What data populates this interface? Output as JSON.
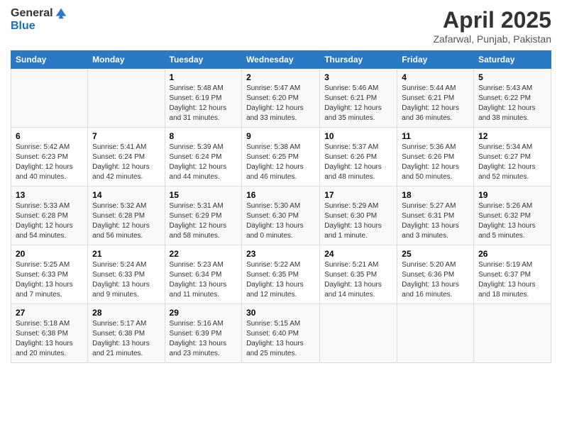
{
  "header": {
    "logo_general": "General",
    "logo_blue": "Blue",
    "title": "April 2025",
    "location": "Zafarwal, Punjab, Pakistan"
  },
  "weekdays": [
    "Sunday",
    "Monday",
    "Tuesday",
    "Wednesday",
    "Thursday",
    "Friday",
    "Saturday"
  ],
  "weeks": [
    [
      {
        "day": "",
        "sunrise": "",
        "sunset": "",
        "daylight": ""
      },
      {
        "day": "",
        "sunrise": "",
        "sunset": "",
        "daylight": ""
      },
      {
        "day": "1",
        "sunrise": "Sunrise: 5:48 AM",
        "sunset": "Sunset: 6:19 PM",
        "daylight": "Daylight: 12 hours and 31 minutes."
      },
      {
        "day": "2",
        "sunrise": "Sunrise: 5:47 AM",
        "sunset": "Sunset: 6:20 PM",
        "daylight": "Daylight: 12 hours and 33 minutes."
      },
      {
        "day": "3",
        "sunrise": "Sunrise: 5:46 AM",
        "sunset": "Sunset: 6:21 PM",
        "daylight": "Daylight: 12 hours and 35 minutes."
      },
      {
        "day": "4",
        "sunrise": "Sunrise: 5:44 AM",
        "sunset": "Sunset: 6:21 PM",
        "daylight": "Daylight: 12 hours and 36 minutes."
      },
      {
        "day": "5",
        "sunrise": "Sunrise: 5:43 AM",
        "sunset": "Sunset: 6:22 PM",
        "daylight": "Daylight: 12 hours and 38 minutes."
      }
    ],
    [
      {
        "day": "6",
        "sunrise": "Sunrise: 5:42 AM",
        "sunset": "Sunset: 6:23 PM",
        "daylight": "Daylight: 12 hours and 40 minutes."
      },
      {
        "day": "7",
        "sunrise": "Sunrise: 5:41 AM",
        "sunset": "Sunset: 6:24 PM",
        "daylight": "Daylight: 12 hours and 42 minutes."
      },
      {
        "day": "8",
        "sunrise": "Sunrise: 5:39 AM",
        "sunset": "Sunset: 6:24 PM",
        "daylight": "Daylight: 12 hours and 44 minutes."
      },
      {
        "day": "9",
        "sunrise": "Sunrise: 5:38 AM",
        "sunset": "Sunset: 6:25 PM",
        "daylight": "Daylight: 12 hours and 46 minutes."
      },
      {
        "day": "10",
        "sunrise": "Sunrise: 5:37 AM",
        "sunset": "Sunset: 6:26 PM",
        "daylight": "Daylight: 12 hours and 48 minutes."
      },
      {
        "day": "11",
        "sunrise": "Sunrise: 5:36 AM",
        "sunset": "Sunset: 6:26 PM",
        "daylight": "Daylight: 12 hours and 50 minutes."
      },
      {
        "day": "12",
        "sunrise": "Sunrise: 5:34 AM",
        "sunset": "Sunset: 6:27 PM",
        "daylight": "Daylight: 12 hours and 52 minutes."
      }
    ],
    [
      {
        "day": "13",
        "sunrise": "Sunrise: 5:33 AM",
        "sunset": "Sunset: 6:28 PM",
        "daylight": "Daylight: 12 hours and 54 minutes."
      },
      {
        "day": "14",
        "sunrise": "Sunrise: 5:32 AM",
        "sunset": "Sunset: 6:28 PM",
        "daylight": "Daylight: 12 hours and 56 minutes."
      },
      {
        "day": "15",
        "sunrise": "Sunrise: 5:31 AM",
        "sunset": "Sunset: 6:29 PM",
        "daylight": "Daylight: 12 hours and 58 minutes."
      },
      {
        "day": "16",
        "sunrise": "Sunrise: 5:30 AM",
        "sunset": "Sunset: 6:30 PM",
        "daylight": "Daylight: 13 hours and 0 minutes."
      },
      {
        "day": "17",
        "sunrise": "Sunrise: 5:29 AM",
        "sunset": "Sunset: 6:30 PM",
        "daylight": "Daylight: 13 hours and 1 minute."
      },
      {
        "day": "18",
        "sunrise": "Sunrise: 5:27 AM",
        "sunset": "Sunset: 6:31 PM",
        "daylight": "Daylight: 13 hours and 3 minutes."
      },
      {
        "day": "19",
        "sunrise": "Sunrise: 5:26 AM",
        "sunset": "Sunset: 6:32 PM",
        "daylight": "Daylight: 13 hours and 5 minutes."
      }
    ],
    [
      {
        "day": "20",
        "sunrise": "Sunrise: 5:25 AM",
        "sunset": "Sunset: 6:33 PM",
        "daylight": "Daylight: 13 hours and 7 minutes."
      },
      {
        "day": "21",
        "sunrise": "Sunrise: 5:24 AM",
        "sunset": "Sunset: 6:33 PM",
        "daylight": "Daylight: 13 hours and 9 minutes."
      },
      {
        "day": "22",
        "sunrise": "Sunrise: 5:23 AM",
        "sunset": "Sunset: 6:34 PM",
        "daylight": "Daylight: 13 hours and 11 minutes."
      },
      {
        "day": "23",
        "sunrise": "Sunrise: 5:22 AM",
        "sunset": "Sunset: 6:35 PM",
        "daylight": "Daylight: 13 hours and 12 minutes."
      },
      {
        "day": "24",
        "sunrise": "Sunrise: 5:21 AM",
        "sunset": "Sunset: 6:35 PM",
        "daylight": "Daylight: 13 hours and 14 minutes."
      },
      {
        "day": "25",
        "sunrise": "Sunrise: 5:20 AM",
        "sunset": "Sunset: 6:36 PM",
        "daylight": "Daylight: 13 hours and 16 minutes."
      },
      {
        "day": "26",
        "sunrise": "Sunrise: 5:19 AM",
        "sunset": "Sunset: 6:37 PM",
        "daylight": "Daylight: 13 hours and 18 minutes."
      }
    ],
    [
      {
        "day": "27",
        "sunrise": "Sunrise: 5:18 AM",
        "sunset": "Sunset: 6:38 PM",
        "daylight": "Daylight: 13 hours and 20 minutes."
      },
      {
        "day": "28",
        "sunrise": "Sunrise: 5:17 AM",
        "sunset": "Sunset: 6:38 PM",
        "daylight": "Daylight: 13 hours and 21 minutes."
      },
      {
        "day": "29",
        "sunrise": "Sunrise: 5:16 AM",
        "sunset": "Sunset: 6:39 PM",
        "daylight": "Daylight: 13 hours and 23 minutes."
      },
      {
        "day": "30",
        "sunrise": "Sunrise: 5:15 AM",
        "sunset": "Sunset: 6:40 PM",
        "daylight": "Daylight: 13 hours and 25 minutes."
      },
      {
        "day": "",
        "sunrise": "",
        "sunset": "",
        "daylight": ""
      },
      {
        "day": "",
        "sunrise": "",
        "sunset": "",
        "daylight": ""
      },
      {
        "day": "",
        "sunrise": "",
        "sunset": "",
        "daylight": ""
      }
    ]
  ]
}
